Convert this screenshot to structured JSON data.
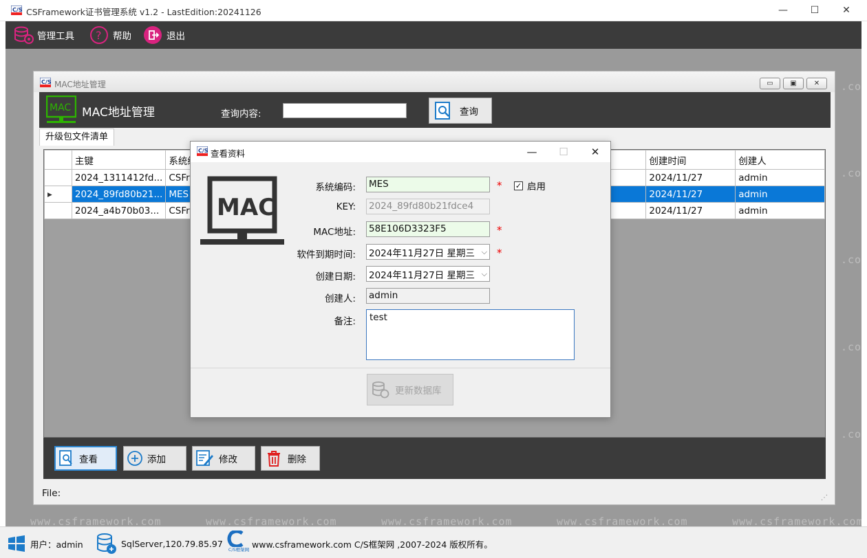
{
  "window": {
    "title": "CSFramework证书管理系统 v1.2 - LastEdition:20241126",
    "minimize": "—",
    "maximize": "☐",
    "close": "✕"
  },
  "menu": {
    "tools": "管理工具",
    "help": "帮助",
    "exit": "退出"
  },
  "watermark": "www.csframework.com",
  "watermark_short": ".com",
  "mdi": {
    "title": "MAC地址管理",
    "heading": "MAC地址管理",
    "logo_text": "MAC",
    "query_label": "查询内容:",
    "query_value": "",
    "query_button": "查询",
    "tab": "升级包文件清单",
    "columns": [
      "主键",
      "系统编",
      "创建时间",
      "创建人"
    ],
    "rows": [
      {
        "key": "2024_1311412fd...",
        "sys": "CSFra",
        "created": "2024/11/27",
        "creator": "admin"
      },
      {
        "key": "2024_89fd80b21...",
        "sys": "MES",
        "created": "2024/11/27",
        "creator": "admin"
      },
      {
        "key": "2024_a4b70b03...",
        "sys": "CSFra",
        "created": "2024/11/27",
        "creator": "admin"
      }
    ],
    "row_indicator": "▸",
    "buttons": {
      "view": "查看",
      "add": "添加",
      "edit": "修改",
      "delete": "删除"
    },
    "status": "File:",
    "ctl_min": "▭",
    "ctl_max": "▣",
    "ctl_close": "✕"
  },
  "dialog": {
    "title": "查看资料",
    "logo_text": "MAC",
    "labels": {
      "sys_code": "系统编码:",
      "key": "KEY:",
      "mac": "MAC地址:",
      "expire": "软件到期时间:",
      "created": "创建日期:",
      "creator": "创建人:",
      "remark": "备注:"
    },
    "values": {
      "sys_code": "MES",
      "key": "2024_89fd80b21fdce4",
      "mac": "58E106D3323F5",
      "expire": "2024年11月27日 星期三",
      "created": "2024年11月27日 星期三",
      "creator": "admin",
      "remark": "test"
    },
    "enabled_label": "启用",
    "enabled_checked": true,
    "required_mark": "*",
    "dropdown_arrow": "⌵",
    "update_button": "更新数据库",
    "ctl_min": "—",
    "ctl_max": "☐",
    "ctl_close": "✕"
  },
  "statusbar": {
    "user": "用户：admin",
    "server": "SqlServer,120.79.85.97",
    "logo_caption": "C/S框架网",
    "copyright": "www.csframework.com C/S框架网 ,2007-2024 版权所有。"
  },
  "colors": {
    "accent_green": "#2db500",
    "selection_blue": "#0a78d7",
    "menu_magenta": "#c8237a",
    "dark_bar": "#3b3b3b"
  },
  "icons": [
    "cs-app-icon",
    "database-gear-icon",
    "help-circle-icon",
    "exit-icon",
    "mac-monitor-icon",
    "search-doc-icon",
    "view-icon",
    "add-circle-icon",
    "edit-icon",
    "trash-icon",
    "database-update-icon",
    "windows-user-icon",
    "database-server-icon",
    "csframework-logo-icon"
  ]
}
